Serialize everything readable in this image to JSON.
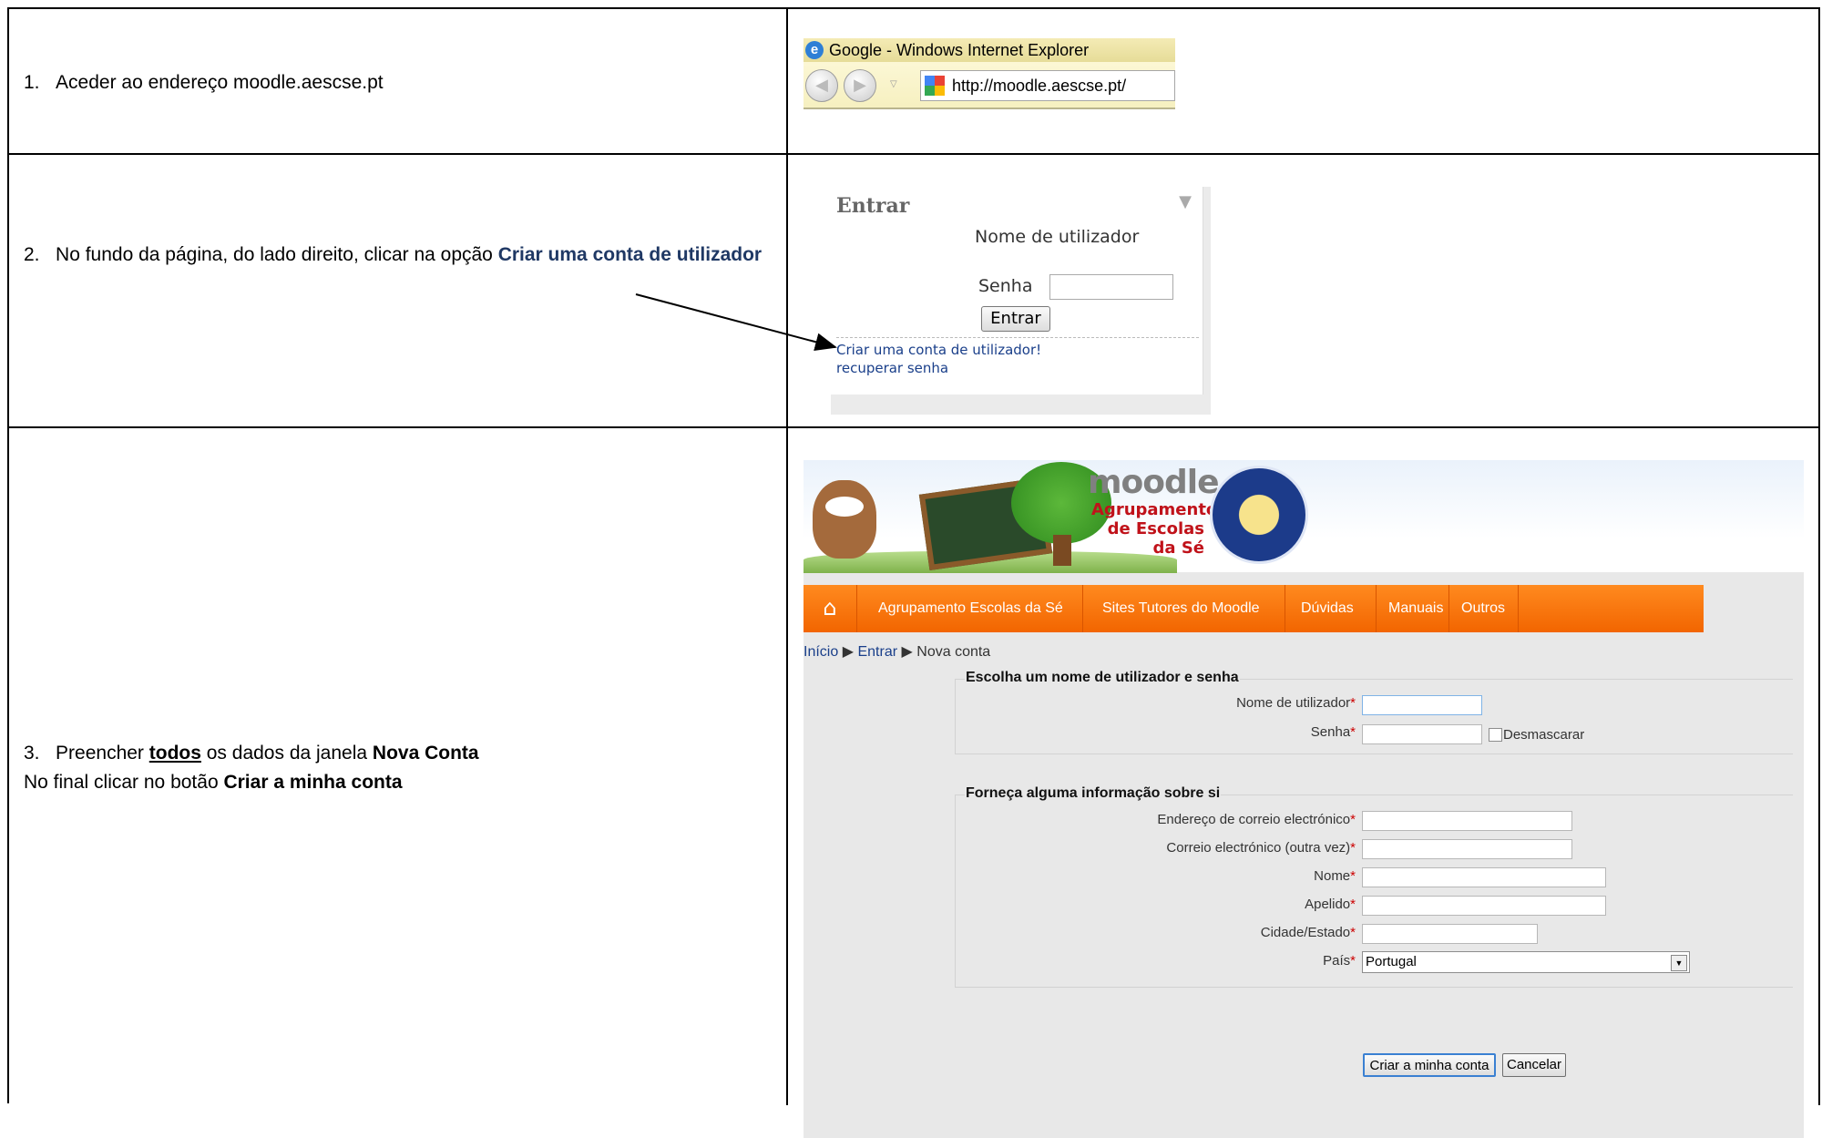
{
  "steps": [
    {
      "number": "1.",
      "text": "Aceder ao endereço moodle.aescse.pt"
    },
    {
      "number": "2.",
      "text_before": "No fundo da página, do lado direito, clicar na opção ",
      "link_text": "Criar uma conta de utilizador"
    },
    {
      "number": "3.",
      "line1_before": "Preencher ",
      "line1_underlined": "todos",
      "line1_middle": " os dados da janela ",
      "line1_bold": "Nova Conta",
      "line2_before": "No final clicar no botão ",
      "line2_bold": "Criar a minha conta"
    }
  ],
  "browser": {
    "title": "Google - Windows Internet Explorer",
    "address": "http://moodle.aescse.pt/"
  },
  "login_block": {
    "title": "Entrar",
    "username_label": "Nome de utilizador",
    "password_label": "Senha",
    "submit_label": "Entrar",
    "create_account_link": "Criar uma conta de utilizador!",
    "recover_password_link": "recuperar senha"
  },
  "moodle": {
    "logo_text": "moodle",
    "school_name_lines": [
      "Agrupamento",
      "de Escolas",
      "da Sé"
    ],
    "menu": [
      "Agrupamento Escolas da Sé",
      "Sites Tutores do Moodle",
      "Dúvidas",
      "Manuais",
      "Outros"
    ],
    "breadcrumb": {
      "home": "Início",
      "login": "Entrar",
      "current": "Nova conta",
      "separator": "▶"
    },
    "fieldset1": {
      "legend": "Escolha um nome de utilizador e senha",
      "username_label": "Nome de utilizador",
      "password_label": "Senha",
      "unmask_label": "Desmascarar"
    },
    "fieldset2": {
      "legend": "Forneça alguma informação sobre si",
      "email_label": "Endereço de correio electrónico",
      "email2_label": "Correio electrónico (outra vez)",
      "firstname_label": "Nome",
      "lastname_label": "Apelido",
      "city_label": "Cidade/Estado",
      "country_label": "País",
      "country_value": "Portugal"
    },
    "required_mark": "*",
    "submit_label": "Criar a minha conta",
    "cancel_label": "Cancelar"
  }
}
